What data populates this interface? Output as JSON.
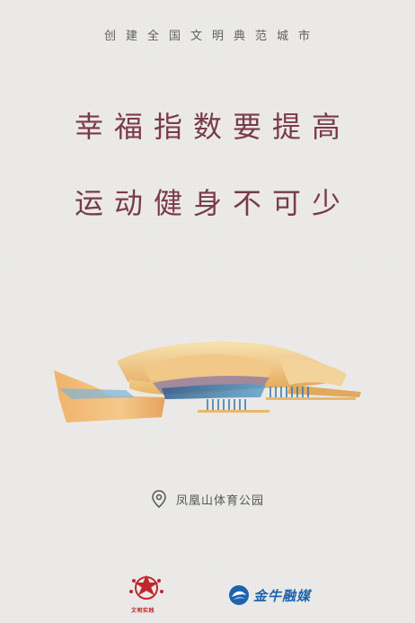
{
  "poster": {
    "top_slogan": "创建全国文明典范城市",
    "headline_line1": "幸福指数要提高",
    "headline_line2": "运动健身不可少",
    "location_name": "凤凰山体育公园",
    "location_icon": "location-pin-icon"
  },
  "logos": {
    "left_logo_text": "文明实践",
    "right_logo_text": "金牛融媒"
  },
  "colors": {
    "background": "#ecebe9",
    "headline": "#7a3a4c",
    "stadium_gold": "#e9b86a",
    "stadium_blue": "#3f7cad",
    "left_logo_red": "#c0262d",
    "right_logo_blue": "#1d63ae"
  }
}
